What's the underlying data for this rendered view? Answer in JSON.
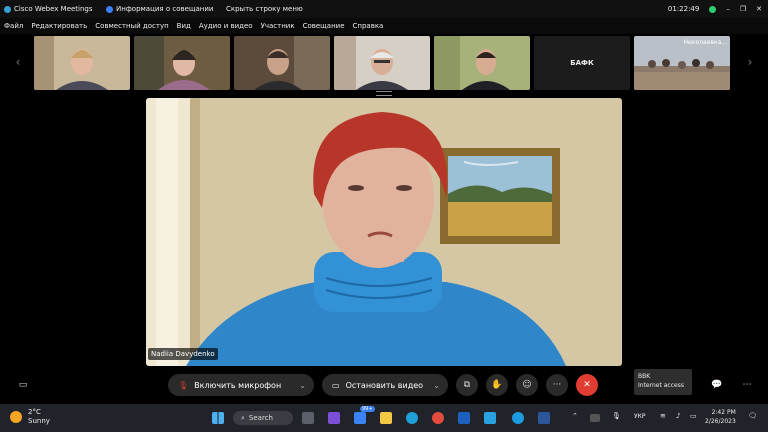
{
  "titlebar": {
    "app_title": "Cisco Webex Meetings",
    "meeting_info": "Информация о совещании",
    "hide_menu": "Скрыть строку меню",
    "timer": "01:22:49"
  },
  "menu": {
    "items": [
      "Файл",
      "Редактировать",
      "Совместный доступ",
      "Вид",
      "Аудио и видео",
      "Участник",
      "Совещание",
      "Справка"
    ]
  },
  "thumbnails": {
    "labels": [
      "",
      "",
      "",
      "",
      "",
      "БАФК",
      "Николаевка..."
    ]
  },
  "main": {
    "speaker_name": "Nadiia Davydenko"
  },
  "controls": {
    "mute_label": "Включить микрофон",
    "video_label": "Остановить видео",
    "more_glyph": "···",
    "end_glyph": "✕"
  },
  "tooltip": {
    "title": "BBK",
    "subtitle": "Internet access"
  },
  "taskbar": {
    "temperature": "2°C",
    "weather": "Sunny",
    "search_label": "Search",
    "badge_count": "99+",
    "language": "УКР",
    "time": "2:42 PM",
    "date": "2/26/2023"
  },
  "colors": {
    "accent_end": "#e03c31",
    "status_green": "#2ecc71"
  }
}
